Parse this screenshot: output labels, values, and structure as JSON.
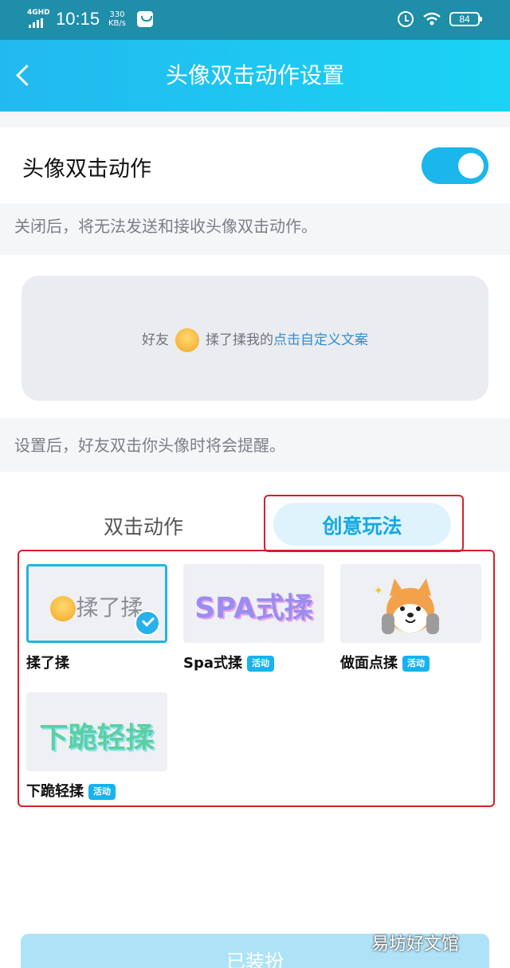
{
  "status_bar": {
    "network": "4GHD",
    "time": "10:15",
    "speed_value": "330",
    "speed_unit": "KB/s",
    "battery": "84"
  },
  "header": {
    "title": "头像双击动作设置"
  },
  "toggle_setting": {
    "label": "头像双击动作",
    "enabled": true,
    "hint": "关闭后，将无法发送和接收头像双击动作。"
  },
  "preview": {
    "friend": "好友",
    "action_text": "揉了揉我的",
    "custom_link": "点击自定义文案",
    "hint": "设置后，好友双击你头像时将会提醒。"
  },
  "tabs": [
    {
      "label": "双击动作",
      "active": false
    },
    {
      "label": "创意玩法",
      "active": true
    }
  ],
  "actions": [
    {
      "name": "揉了揉",
      "art_text": "揉了揉",
      "badge": "",
      "selected": true
    },
    {
      "name": "Spa式揉",
      "art_text": "SPA式揉",
      "badge": "活动",
      "selected": false
    },
    {
      "name": "做面点揉",
      "art_text": "",
      "badge": "活动",
      "selected": false
    },
    {
      "name": "下跪轻揉",
      "art_text": "下跪轻揉",
      "badge": "活动",
      "selected": false
    }
  ],
  "footer": {
    "button_label": "已装扮",
    "watermark": "易坊好文馆"
  },
  "colors": {
    "accent": "#1ab6ec",
    "highlight_box": "#d61f2b",
    "badge": "#18b2ee"
  }
}
